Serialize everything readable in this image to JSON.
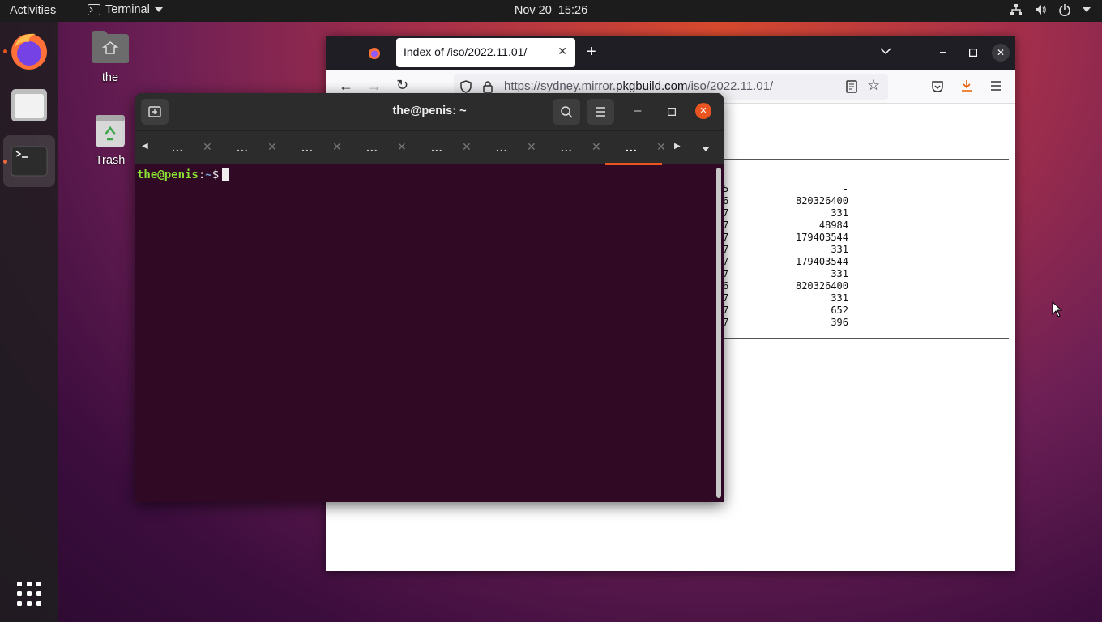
{
  "topbar": {
    "activities": "Activities",
    "app_name": "Terminal",
    "clock": "Nov 20  15:26"
  },
  "dock": {
    "items": [
      "firefox-icon",
      "files-icon",
      "terminal-icon"
    ],
    "apps_grid": "show-applications-icon"
  },
  "desktop": {
    "home_label": "the",
    "trash_label": "Trash"
  },
  "firefox": {
    "tab_title": "Index of /iso/2022.11.01/",
    "url_prefix": "https://sydney.mirror.",
    "url_host": "pkgbuild.com",
    "url_path": "/iso/2022.11.01/",
    "listing": [
      {
        "col": "5",
        "size": "-"
      },
      {
        "col": "6",
        "size": "820326400"
      },
      {
        "col": "7",
        "size": "331"
      },
      {
        "col": "7",
        "size": "48984"
      },
      {
        "col": "7",
        "size": "179403544"
      },
      {
        "col": "7",
        "size": "331"
      },
      {
        "col": "7",
        "size": "179403544"
      },
      {
        "col": "7",
        "size": "331"
      },
      {
        "col": "6",
        "size": "820326400"
      },
      {
        "col": "7",
        "size": "331"
      },
      {
        "col": "7",
        "size": "652"
      },
      {
        "col": "7",
        "size": "396"
      }
    ]
  },
  "terminal": {
    "title": "the@penis: ~",
    "tabs": [
      "...",
      "...",
      "...",
      "...",
      "...",
      "...",
      "...",
      "..."
    ],
    "prompt_user": "the@penis",
    "prompt_sep": ":",
    "prompt_dir": "~",
    "prompt_sym": "$"
  },
  "colors": {
    "accent": "#e95420",
    "terminal_bg": "#300a24",
    "prompt_user": "#8ae234",
    "prompt_dir": "#729fcf"
  }
}
